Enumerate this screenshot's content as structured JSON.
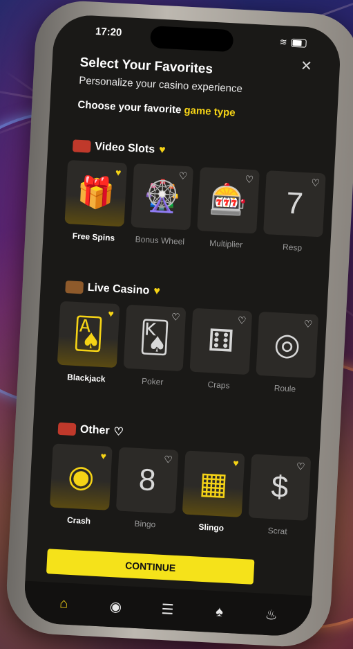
{
  "status": {
    "time": "17:20"
  },
  "header": {
    "title": "Select Your Favorites",
    "subtitle": "Personalize your casino experience",
    "choose_prefix": "Choose your favorite ",
    "choose_highlight": "game type"
  },
  "sections": [
    {
      "title": "Video Slots",
      "favorited": true,
      "items": [
        {
          "label": "Free Spins",
          "favorited": true,
          "icon": "gift-icon",
          "glyph": "🎁"
        },
        {
          "label": "Bonus Wheel",
          "favorited": false,
          "icon": "wheel-icon",
          "glyph": "🎡"
        },
        {
          "label": "Multiplier",
          "favorited": false,
          "icon": "slot-machine-icon",
          "glyph": "🎰"
        },
        {
          "label": "Resp",
          "favorited": false,
          "icon": "sevens-icon",
          "glyph": "7"
        }
      ]
    },
    {
      "title": "Live Casino",
      "favorited": true,
      "items": [
        {
          "label": "Blackjack",
          "favorited": true,
          "icon": "cards-chip-icon",
          "glyph": "🂡"
        },
        {
          "label": "Poker",
          "favorited": false,
          "icon": "cards-icon",
          "glyph": "🂮"
        },
        {
          "label": "Craps",
          "favorited": false,
          "icon": "dice-icon",
          "glyph": "⚅"
        },
        {
          "label": "Roule",
          "favorited": false,
          "icon": "roulette-icon",
          "glyph": "◎"
        }
      ]
    },
    {
      "title": "Other",
      "favorited": false,
      "items": [
        {
          "label": "Crash",
          "favorited": true,
          "icon": "crash-ball-icon",
          "glyph": "◉"
        },
        {
          "label": "Bingo",
          "favorited": false,
          "icon": "bingo-icon",
          "glyph": "8"
        },
        {
          "label": "Slingo",
          "favorited": true,
          "icon": "slingo-grid-icon",
          "glyph": "▦"
        },
        {
          "label": "Scrat",
          "favorited": false,
          "icon": "scratch-card-icon",
          "glyph": "$"
        }
      ]
    }
  ],
  "continue_label": "CONTINUE",
  "tabs": [
    {
      "icon": "home-icon",
      "glyph": "⌂",
      "active": true
    },
    {
      "icon": "live-broadcast-icon",
      "glyph": "◉",
      "active": false
    },
    {
      "icon": "list-icon",
      "glyph": "☰",
      "active": false
    },
    {
      "icon": "cards-icon",
      "glyph": "♠",
      "active": false
    },
    {
      "icon": "flame-icon",
      "glyph": "♨",
      "active": false
    }
  ],
  "colors": {
    "accent": "#f5d316",
    "button": "#f5e21a",
    "screen_bg": "#1a1917"
  }
}
